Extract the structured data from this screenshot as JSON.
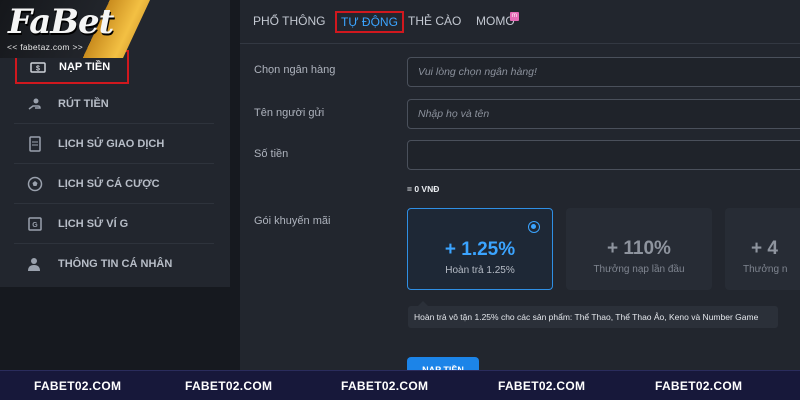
{
  "brand": {
    "logo_text": "FaBet",
    "logo_sub": "<< fabetaz.com >>"
  },
  "sidebar": {
    "items": [
      {
        "label": "NẠP TIỀN",
        "icon": "cash-icon",
        "active": true
      },
      {
        "label": "RÚT TIỀN",
        "icon": "withdraw-icon",
        "active": false
      },
      {
        "label": "LỊCH SỬ GIAO DỊCH",
        "icon": "document-icon",
        "active": false
      },
      {
        "label": "LỊCH SỬ CÁ CƯỢC",
        "icon": "soccer-ball-icon",
        "active": false
      },
      {
        "label": "LỊCH SỬ VÍ G",
        "icon": "wallet-history-icon",
        "active": false
      },
      {
        "label": "THÔNG TIN CÁ NHÂN",
        "icon": "user-icon",
        "active": false
      }
    ]
  },
  "tabs": [
    {
      "label": "PHỔ THÔNG",
      "active": false
    },
    {
      "label": "TỰ ĐỘNG",
      "active": true
    },
    {
      "label": "THẺ CÀO",
      "active": false
    },
    {
      "label": "MOMO",
      "active": false
    }
  ],
  "form": {
    "bank_label": "Chọn ngân hàng",
    "bank_placeholder": "Vui lòng chọn ngân hàng!",
    "sender_label": "Tên người gửi",
    "sender_placeholder": "Nhập họ và tên",
    "amount_label": "Số tiền",
    "amount_value": "",
    "amount_note": "= 0 VNĐ",
    "promo_label": "Gói khuyến mãi"
  },
  "promos": [
    {
      "value": "+ 1.25%",
      "subtitle": "Hoàn trả 1.25%",
      "selected": true
    },
    {
      "value": "+ 110%",
      "subtitle": "Thưởng nạp lần đầu",
      "selected": false
    },
    {
      "value": "+ 4",
      "subtitle": "Thưởng n",
      "selected": false
    }
  ],
  "tooltip": "Hoàn trả vô tận 1.25% cho các sản phẩm: Thể Thao, Thể Thao Ảo, Keno và Number Game",
  "submit_label": "NẠP TIỀN",
  "watermark": [
    "FABET02.COM",
    "FABET02.COM",
    "FABET02.COM",
    "FABET02.COM",
    "FABET02.COM"
  ],
  "colors": {
    "accent": "#3ba4ff",
    "highlight_box": "#d0181e",
    "panel_bg": "#22262e",
    "page_bg": "#16191f"
  }
}
